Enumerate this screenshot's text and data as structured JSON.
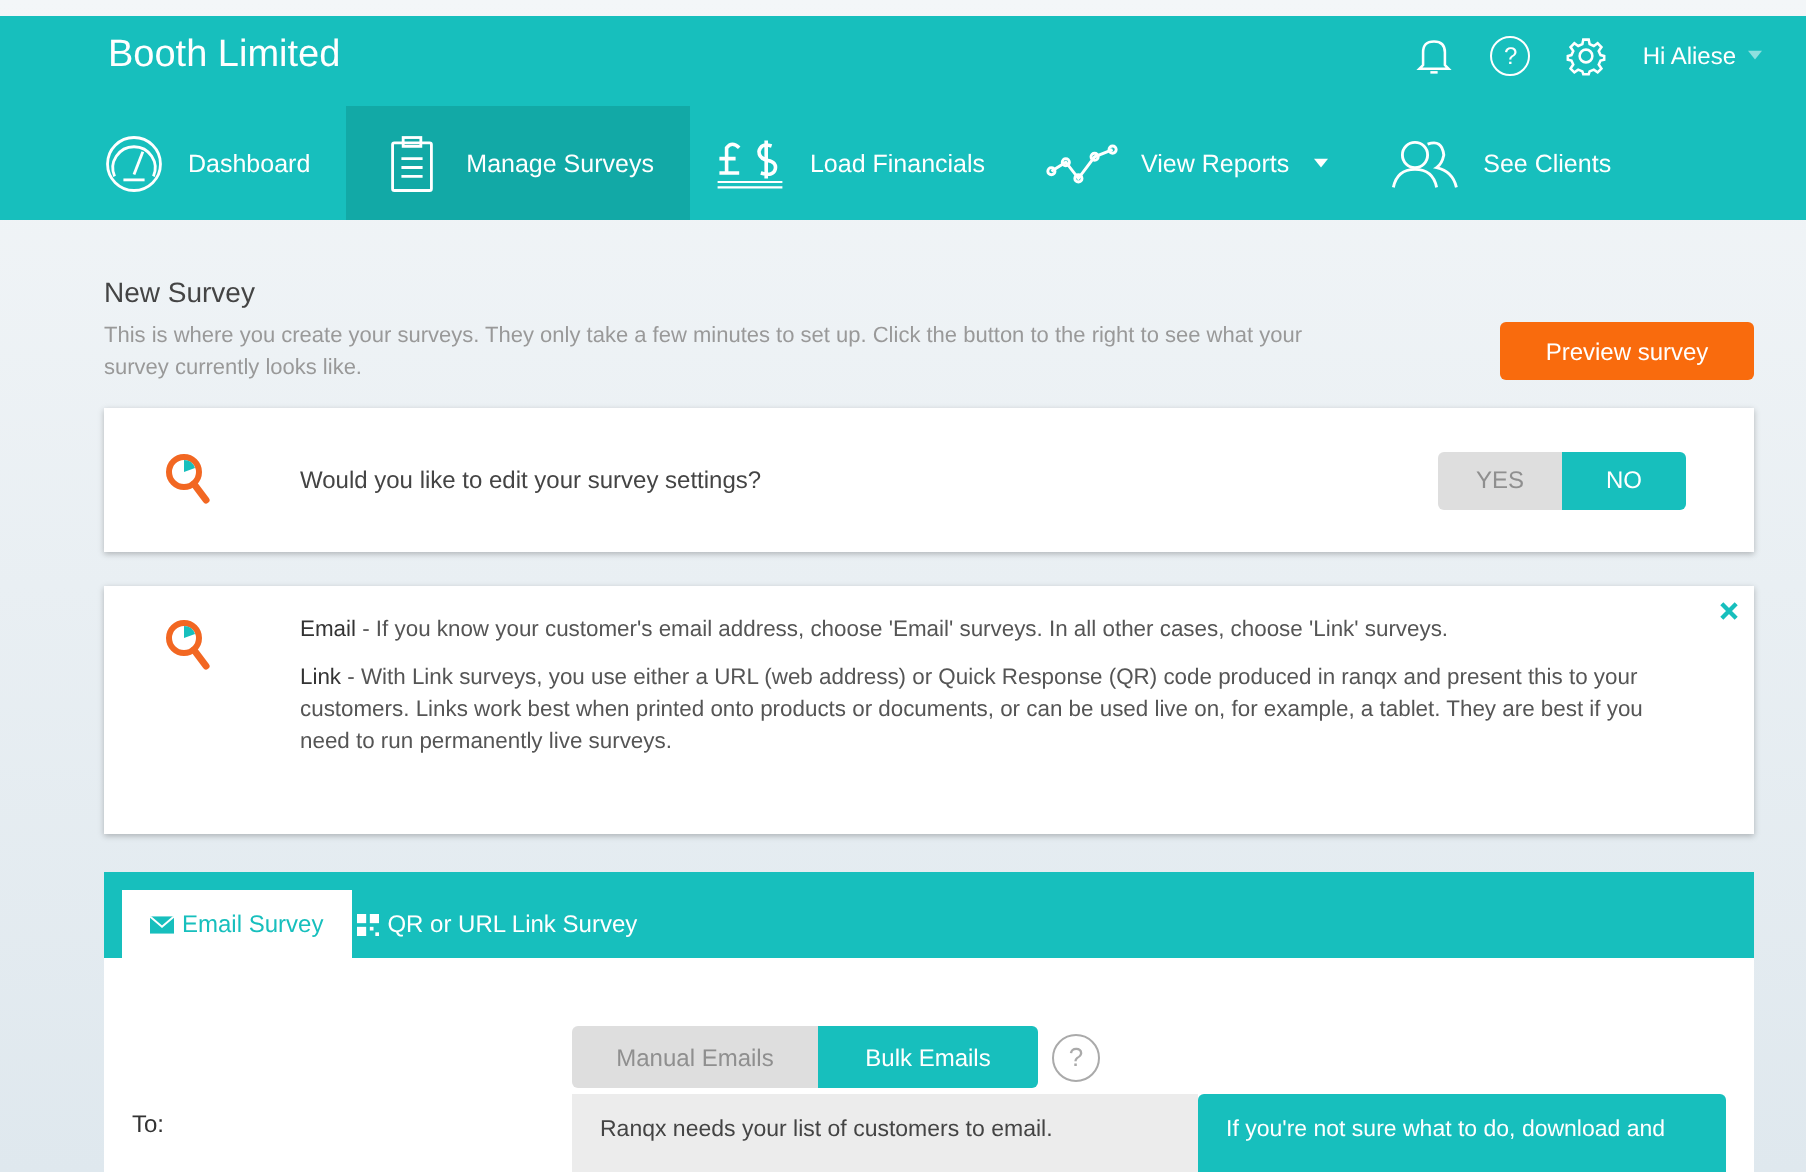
{
  "header": {
    "title": "Booth Limited",
    "help_label": "?",
    "user": "Hi Aliese"
  },
  "nav": [
    {
      "label": "Dashboard",
      "selected": false,
      "has_menu": false
    },
    {
      "label": "Manage Surveys",
      "selected": true,
      "has_menu": false
    },
    {
      "label": "Load Financials",
      "selected": false,
      "has_menu": false
    },
    {
      "label": "View Reports",
      "selected": false,
      "has_menu": true
    },
    {
      "label": "See Clients",
      "selected": false,
      "has_menu": false
    }
  ],
  "page": {
    "title": "New Survey",
    "description": "This is where you create your surveys. They only take a few minutes to set up. Click the button to the right to see what your survey currently looks like.",
    "preview_button": "Preview survey"
  },
  "settings_card": {
    "question": "Would you like to edit your survey settings?",
    "options": [
      {
        "label": "YES",
        "selected": false
      },
      {
        "label": "NO",
        "selected": true
      }
    ]
  },
  "info_card": {
    "paragraphs": [
      "**Email** - If you know your customer's email address, choose 'Email' surveys. In all other cases, choose 'Link' surveys.",
      "**Link** - With Link surveys, you use either a URL (web address) or Quick Response (QR) code produced in ranqx and present this to your customers. Links work best when printed onto products or documents, or can be used live on, for example, a tablet. They are best if you need to run permanently live surveys."
    ]
  },
  "survey_tabs": [
    {
      "label": "Email Survey",
      "selected": true
    },
    {
      "label": "QR or URL Link Survey",
      "selected": false
    }
  ],
  "email_form": {
    "to_label": "To:",
    "modes": [
      {
        "label": "Manual Emails",
        "selected": false
      },
      {
        "label": "Bulk Emails",
        "selected": true
      }
    ],
    "help_label": "?",
    "instructions": "Ranqx needs your list of customers to email.",
    "tip": "If you're not sure what to do, download and"
  }
}
